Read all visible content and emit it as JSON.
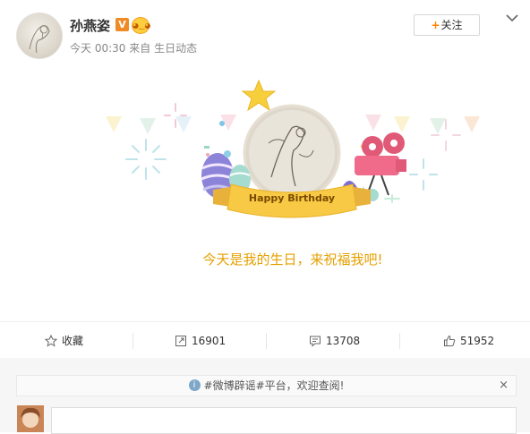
{
  "post": {
    "user_name": "孙燕姿",
    "vip_badge": "V",
    "timestamp": "今天 00:30",
    "source_prefix": "来自",
    "source": "生日动态",
    "follow_label": "关注",
    "image": {
      "banner_text": "Happy Birthday",
      "message": "今天是我的生日，来祝福我吧!"
    }
  },
  "actions": {
    "favorite_label": "收藏",
    "repost_count": "16901",
    "comment_count": "13708",
    "like_count": "51952"
  },
  "notice": {
    "text": "#微博辟谣#平台，欢迎查阅!",
    "close": "×"
  },
  "colors": {
    "accent_orange": "#ff8200",
    "birthday_yellow": "#e5a000",
    "link_blue": "#eb7350"
  }
}
